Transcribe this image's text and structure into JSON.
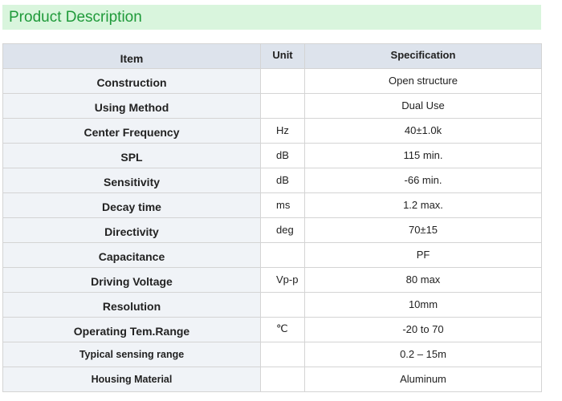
{
  "section": {
    "title": "Product Description"
  },
  "table": {
    "headers": {
      "item": "Item",
      "unit": "Unit",
      "specification": "Specification"
    },
    "rows": [
      {
        "item": "Construction",
        "unit": "",
        "spec": "Open structure"
      },
      {
        "item": "Using Method",
        "unit": "",
        "spec": "Dual Use"
      },
      {
        "item": "Center Frequency",
        "unit": "Hz",
        "spec": "40±1.0k"
      },
      {
        "item": "SPL",
        "unit": "dB",
        "spec": "115 min."
      },
      {
        "item": "Sensitivity",
        "unit": "dB",
        "spec": "-66 min."
      },
      {
        "item": "Decay time",
        "unit": "ms",
        "spec": "1.2 max."
      },
      {
        "item": "Directivity",
        "unit": "deg",
        "spec": "70±15"
      },
      {
        "item": "Capacitance",
        "unit": "",
        "spec": "PF"
      },
      {
        "item": "Driving Voltage",
        "unit": "Vp-p",
        "spec": "80 max"
      },
      {
        "item": "Resolution",
        "unit": "",
        "spec": "10mm"
      },
      {
        "item": "Operating Tem.Range",
        "unit": "℃",
        "spec": "-20 to 70"
      },
      {
        "item": "Typical sensing range",
        "unit": "",
        "spec": "0.2 – 15m"
      },
      {
        "item": "Housing Material",
        "unit": "",
        "spec": "Aluminum"
      }
    ]
  },
  "colors": {
    "title_text": "#1f9a3a",
    "title_background": "#d9f5dd",
    "header_background": "#dde3ec",
    "item_column_background": "#f0f3f7",
    "border": "#d4d4d4"
  }
}
